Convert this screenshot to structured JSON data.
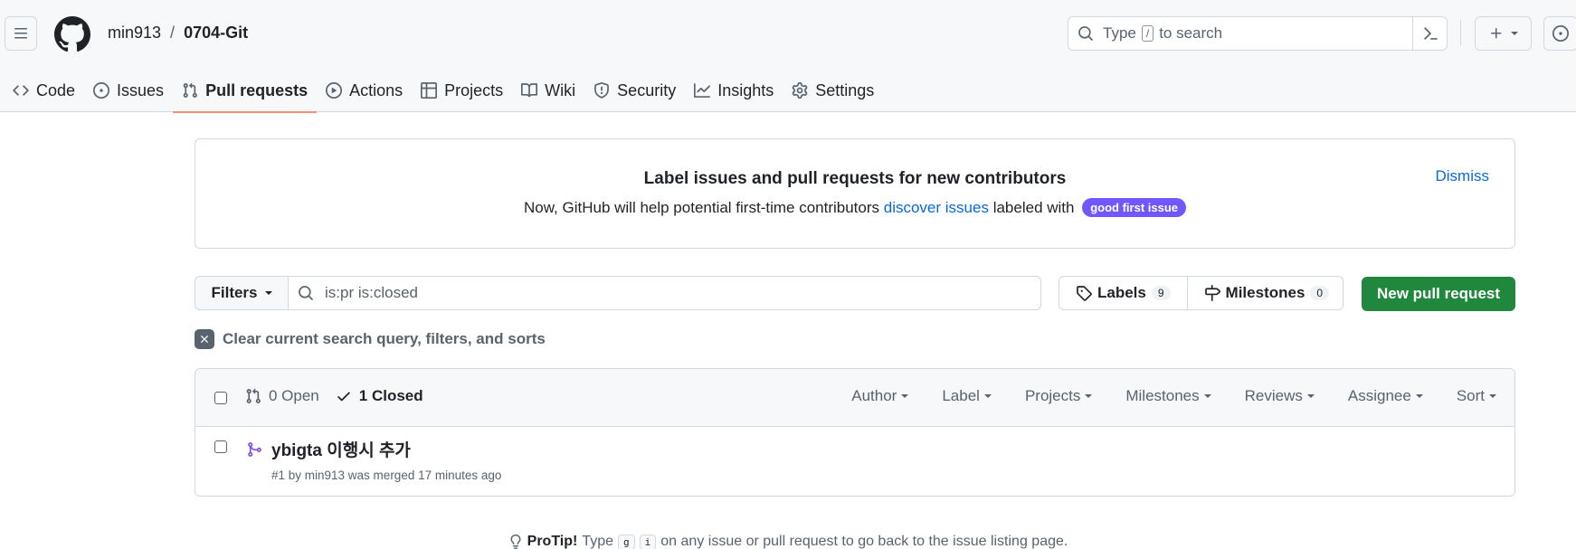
{
  "header": {
    "owner": "min913",
    "separator": "/",
    "repo": "0704-Git",
    "search": {
      "prefix": "Type",
      "key": "/",
      "suffix": "to search"
    }
  },
  "tabs": [
    {
      "label": "Code",
      "icon": "code-icon"
    },
    {
      "label": "Issues",
      "icon": "issue-opened-icon"
    },
    {
      "label": "Pull requests",
      "icon": "git-pull-request-icon",
      "selected": true
    },
    {
      "label": "Actions",
      "icon": "play-icon"
    },
    {
      "label": "Projects",
      "icon": "table-icon"
    },
    {
      "label": "Wiki",
      "icon": "book-icon"
    },
    {
      "label": "Security",
      "icon": "shield-icon"
    },
    {
      "label": "Insights",
      "icon": "graph-icon"
    },
    {
      "label": "Settings",
      "icon": "gear-icon"
    }
  ],
  "banner": {
    "title": "Label issues and pull requests for new contributors",
    "desc_before": "Now, GitHub will help potential first-time contributors",
    "desc_link": "discover issues",
    "desc_after": "labeled with",
    "label": "good first issue",
    "label_color": "#7057ff",
    "dismiss": "Dismiss"
  },
  "filters": {
    "button": "Filters",
    "query": "is:pr is:closed",
    "labels": {
      "label": "Labels",
      "count": "9"
    },
    "milestones": {
      "label": "Milestones",
      "count": "0"
    },
    "new_pr": "New pull request",
    "clear": "Clear current search query, filters, and sorts"
  },
  "list": {
    "open": "0 Open",
    "closed": "1 Closed",
    "selectors": [
      "Author",
      "Label",
      "Projects",
      "Milestones",
      "Reviews",
      "Assignee",
      "Sort"
    ],
    "items": [
      {
        "title": "ybigta 이행시 추가",
        "meta": "#1 by min913 was merged 17 minutes ago",
        "state_color": "#8250df"
      }
    ]
  },
  "protip": {
    "label": "ProTip!",
    "before": "Type",
    "key1": "g",
    "key2": "i",
    "after": "on any issue or pull request to go back to the issue listing page."
  },
  "colors": {
    "accent": "#0969da",
    "primary_button": "#1f883d",
    "tab_underline": "#fd8c73",
    "merged": "#8250df"
  }
}
